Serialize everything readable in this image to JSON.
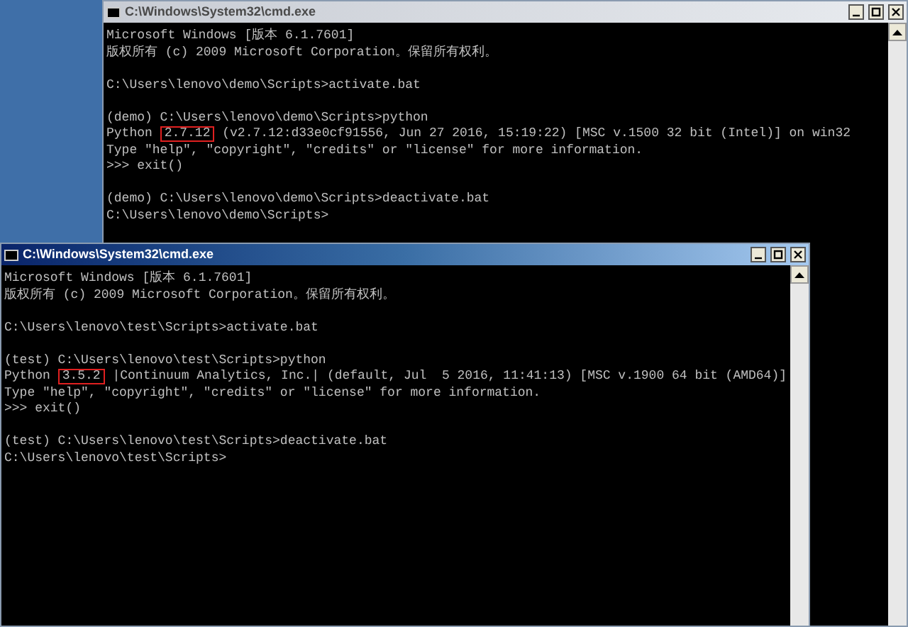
{
  "windows": [
    {
      "title": "C:\\Windows\\System32\\cmd.exe",
      "active": false,
      "lines": [
        {
          "kind": "text",
          "text": "Microsoft Windows [版本 6.1.7601]"
        },
        {
          "kind": "text",
          "text": "版权所有 (c) 2009 Microsoft Corporation。保留所有权利。"
        },
        {
          "kind": "blank"
        },
        {
          "kind": "text",
          "text": "C:\\Users\\lenovo\\demo\\Scripts>activate.bat"
        },
        {
          "kind": "blank"
        },
        {
          "kind": "text",
          "text": "(demo) C:\\Users\\lenovo\\demo\\Scripts>python"
        },
        {
          "kind": "version",
          "prefix": "Python ",
          "version": "2.7.12",
          "rest": " (v2.7.12:d33e0cf91556, Jun 27 2016, 15:19:22) [MSC v.1500 32 bit (Intel)] on win32"
        },
        {
          "kind": "text",
          "text": "Type \"help\", \"copyright\", \"credits\" or \"license\" for more information."
        },
        {
          "kind": "text",
          "text": ">>> exit()"
        },
        {
          "kind": "blank"
        },
        {
          "kind": "text",
          "text": "(demo) C:\\Users\\lenovo\\demo\\Scripts>deactivate.bat"
        },
        {
          "kind": "text",
          "text": "C:\\Users\\lenovo\\demo\\Scripts>"
        }
      ]
    },
    {
      "title": "C:\\Windows\\System32\\cmd.exe",
      "active": true,
      "lines": [
        {
          "kind": "text",
          "text": "Microsoft Windows [版本 6.1.7601]"
        },
        {
          "kind": "text",
          "text": "版权所有 (c) 2009 Microsoft Corporation。保留所有权利。"
        },
        {
          "kind": "blank"
        },
        {
          "kind": "text",
          "text": "C:\\Users\\lenovo\\test\\Scripts>activate.bat"
        },
        {
          "kind": "blank"
        },
        {
          "kind": "text",
          "text": "(test) C:\\Users\\lenovo\\test\\Scripts>python"
        },
        {
          "kind": "version",
          "prefix": "Python ",
          "version": "3.5.2",
          "rest": " |Continuum Analytics, Inc.| (default, Jul  5 2016, 11:41:13) [MSC v.1900 64 bit (AMD64)]"
        },
        {
          "kind": "text",
          "text": "Type \"help\", \"copyright\", \"credits\" or \"license\" for more information."
        },
        {
          "kind": "text",
          "text": ">>> exit()"
        },
        {
          "kind": "blank"
        },
        {
          "kind": "text",
          "text": "(test) C:\\Users\\lenovo\\test\\Scripts>deactivate.bat"
        },
        {
          "kind": "text",
          "text": "C:\\Users\\lenovo\\test\\Scripts>"
        }
      ]
    }
  ]
}
